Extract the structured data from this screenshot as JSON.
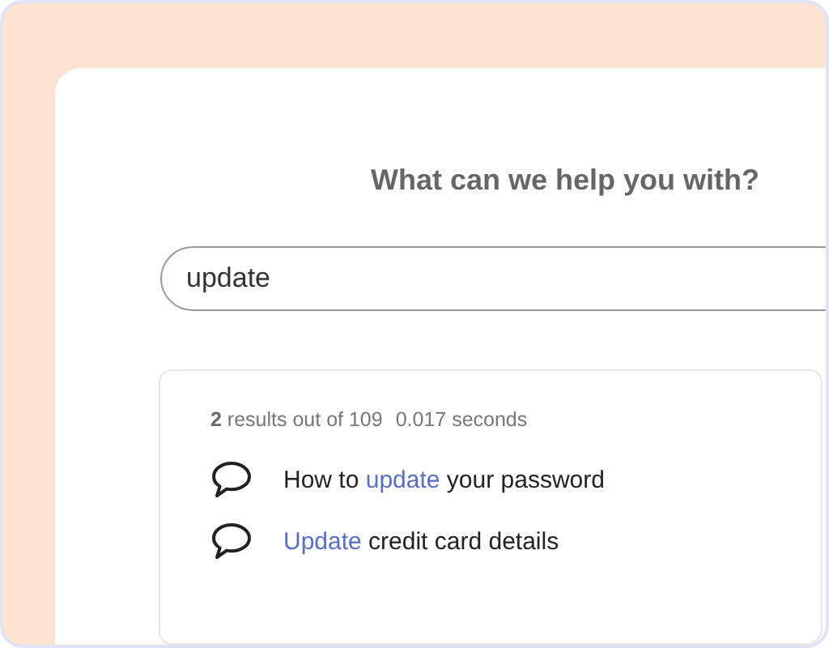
{
  "heading": "What can we help you with?",
  "search": {
    "value": "update"
  },
  "stats": {
    "count": "**2** results out of 109",
    "time": "0.017 seconds"
  },
  "results": [
    {
      "parts": [
        {
          "text": "How to ",
          "highlight": false
        },
        {
          "text": "update",
          "highlight": true
        },
        {
          "text": " your password",
          "highlight": false
        }
      ]
    },
    {
      "parts": [
        {
          "text": "Update",
          "highlight": true
        },
        {
          "text": " credit card details",
          "highlight": false
        }
      ]
    }
  ]
}
